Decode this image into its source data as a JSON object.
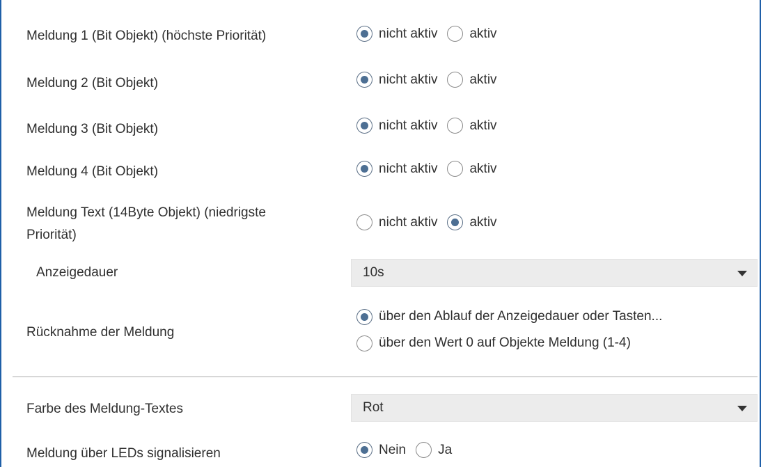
{
  "rows": {
    "m1": {
      "label": "Meldung 1 (Bit Objekt) (höchste Priorität)",
      "options": [
        "nicht aktiv",
        "aktiv"
      ],
      "selected": "nicht aktiv"
    },
    "m2": {
      "label": "Meldung 2 (Bit Objekt)",
      "options": [
        "nicht aktiv",
        "aktiv"
      ],
      "selected": "nicht aktiv"
    },
    "m3": {
      "label": "Meldung 3 (Bit Objekt)",
      "options": [
        "nicht aktiv",
        "aktiv"
      ],
      "selected": "nicht aktiv"
    },
    "m4": {
      "label": "Meldung 4 (Bit Objekt)",
      "options": [
        "nicht aktiv",
        "aktiv"
      ],
      "selected": "nicht aktiv"
    },
    "mtext": {
      "label_line1": "Meldung Text (14Byte Objekt) (niedrigste",
      "label_line2": "Priorität)",
      "options": [
        "nicht aktiv",
        "aktiv"
      ],
      "selected": "aktiv"
    },
    "anzeigedauer": {
      "label": "Anzeigedauer",
      "value": "10s"
    },
    "ruecknahme": {
      "label": "Rücknahme der Meldung",
      "options": [
        "über den Ablauf der Anzeigedauer oder Tasten...",
        "über den Wert 0 auf Objekte Meldung (1-4)"
      ],
      "selected": "über den Ablauf der Anzeigedauer oder Tasten..."
    },
    "farbe": {
      "label": "Farbe des Meldung-Textes",
      "value": "Rot"
    },
    "leds": {
      "label": "Meldung über LEDs signalisieren",
      "options": [
        "Nein",
        "Ja"
      ],
      "selected": "Nein"
    }
  },
  "colors": {
    "frame_border": "#1f5fa8",
    "radio_dot": "#4d6f93",
    "select_bg": "#ececec"
  },
  "icons": {
    "dropdown": "chevron-down-icon"
  }
}
